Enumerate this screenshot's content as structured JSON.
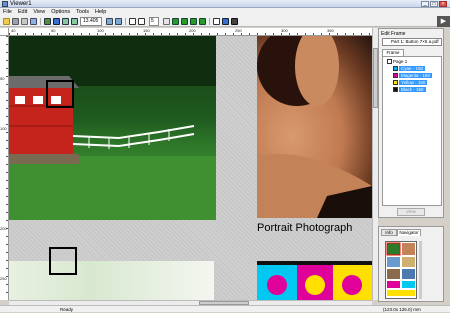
{
  "window": {
    "title": "Viewer1",
    "minimize": "_",
    "maximize": "□",
    "close": "×"
  },
  "menu": [
    "File",
    "Edit",
    "View",
    "Options",
    "Tools",
    "Help"
  ],
  "toolbar": {
    "zoom": "13.405",
    "page": "5"
  },
  "rulers": {
    "h_ticks": [
      "40",
      "50",
      "100",
      "150",
      "200",
      "250",
      "300",
      "350"
    ],
    "v_ticks": [
      "50",
      "100",
      "200",
      "250"
    ]
  },
  "canvas": {
    "portrait_caption": "Portrait Photograph"
  },
  "layers_panel": {
    "title": "Edit Frame",
    "dropdown": "Part 1: Button 7×5 a.pdf",
    "tab": "Frame View",
    "tree_root": "Page 1",
    "items": [
      {
        "label": "Cyan - 150",
        "color": "#00b0f0"
      },
      {
        "label": "Magenta - 150",
        "color": "#e000a0"
      },
      {
        "label": "Yellow - 150",
        "color": "#ffe000"
      },
      {
        "label": "Black - 150",
        "color": "#111111"
      }
    ],
    "view_button": "View"
  },
  "navigator": {
    "tab_info": "Info",
    "tab_navigator": "Navigator"
  },
  "status": {
    "ready": "Ready",
    "coords": "(123.0x 126.0)  mm"
  },
  "colors": {
    "accent": "#3399ff",
    "bridge_red": "#c4241c"
  }
}
